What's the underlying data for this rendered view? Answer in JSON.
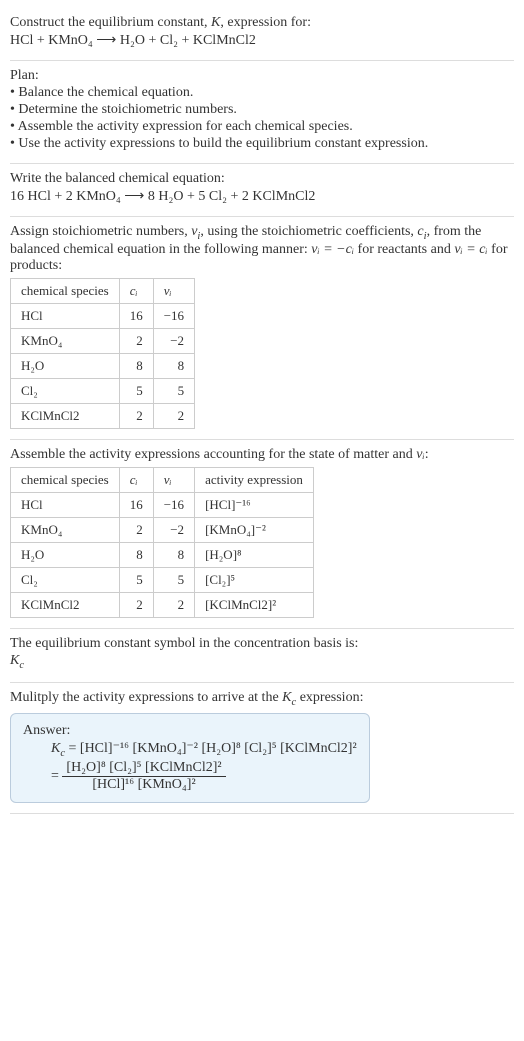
{
  "intro": {
    "l1_a": "Construct the equilibrium constant, ",
    "l1_b": "K",
    "l1_c": ", expression for:",
    "eq": "HCl + KMnO₄  ⟶  H₂O + Cl₂ + KClMnCl2"
  },
  "plan": {
    "heading": "Plan:",
    "b1": "• Balance the chemical equation.",
    "b2": "• Determine the stoichiometric numbers.",
    "b3": "• Assemble the activity expression for each chemical species.",
    "b4": "• Use the activity expressions to build the equilibrium constant expression."
  },
  "balanced": {
    "l1": "Write the balanced chemical equation:",
    "eq": "16 HCl + 2 KMnO₄  ⟶  8 H₂O + 5 Cl₂ + 2 KClMnCl2"
  },
  "stoich": {
    "desc_a": "Assign stoichiometric numbers, ",
    "desc_b": "ν",
    "desc_b_sub": "i",
    "desc_c": ", using the stoichiometric coefficients, ",
    "desc_d": "c",
    "desc_d_sub": "i",
    "desc_e": ", from the balanced chemical equation in the following manner: ",
    "rel1": "νᵢ = −cᵢ",
    "desc_f": " for reactants and ",
    "rel2": "νᵢ = cᵢ",
    "desc_g": " for products:",
    "headers": {
      "species": "chemical species",
      "c": "cᵢ",
      "nu": "νᵢ"
    },
    "rows": [
      {
        "species": "HCl",
        "c": "16",
        "nu": "−16"
      },
      {
        "species": "KMnO₄",
        "c": "2",
        "nu": "−2"
      },
      {
        "species": "H₂O",
        "c": "8",
        "nu": "8"
      },
      {
        "species": "Cl₂",
        "c": "5",
        "nu": "5"
      },
      {
        "species": "KClMnCl2",
        "c": "2",
        "nu": "2"
      }
    ]
  },
  "activity": {
    "desc_a": "Assemble the activity expressions accounting for the state of matter and ",
    "desc_b": "νᵢ",
    "desc_c": ":",
    "headers": {
      "species": "chemical species",
      "c": "cᵢ",
      "nu": "νᵢ",
      "act": "activity expression"
    },
    "rows": [
      {
        "species": "HCl",
        "c": "16",
        "nu": "−16",
        "act": "[HCl]⁻¹⁶"
      },
      {
        "species": "KMnO₄",
        "c": "2",
        "nu": "−2",
        "act": "[KMnO₄]⁻²"
      },
      {
        "species": "H₂O",
        "c": "8",
        "nu": "8",
        "act": "[H₂O]⁸"
      },
      {
        "species": "Cl₂",
        "c": "5",
        "nu": "5",
        "act": "[Cl₂]⁵"
      },
      {
        "species": "KClMnCl2",
        "c": "2",
        "nu": "2",
        "act": "[KClMnCl2]²"
      }
    ]
  },
  "symbol": {
    "l1": "The equilibrium constant symbol in the concentration basis is:",
    "l2": "K",
    "l2_sub": "c"
  },
  "final": {
    "l1_a": "Mulitply the activity expressions to arrive at the ",
    "l1_b": "K",
    "l1_b_sub": "c",
    "l1_c": " expression:",
    "answer_label": "Answer:",
    "lhs": "K",
    "lhs_sub": "c",
    "eq1_rhs": " = [HCl]⁻¹⁶ [KMnO₄]⁻² [H₂O]⁸ [Cl₂]⁵ [KClMnCl2]²",
    "eq2_prefix": "= ",
    "frac_num": "[H₂O]⁸ [Cl₂]⁵ [KClMnCl2]²",
    "frac_den": "[HCl]¹⁶ [KMnO₄]²"
  },
  "chart_data": {
    "type": "table",
    "tables": [
      {
        "title": "Stoichiometric numbers",
        "columns": [
          "chemical species",
          "cᵢ",
          "νᵢ"
        ],
        "rows": [
          [
            "HCl",
            16,
            -16
          ],
          [
            "KMnO₄",
            2,
            -2
          ],
          [
            "H₂O",
            8,
            8
          ],
          [
            "Cl₂",
            5,
            5
          ],
          [
            "KClMnCl2",
            2,
            2
          ]
        ]
      },
      {
        "title": "Activity expressions",
        "columns": [
          "chemical species",
          "cᵢ",
          "νᵢ",
          "activity expression"
        ],
        "rows": [
          [
            "HCl",
            16,
            -16,
            "[HCl]^-16"
          ],
          [
            "KMnO₄",
            2,
            -2,
            "[KMnO4]^-2"
          ],
          [
            "H₂O",
            8,
            8,
            "[H2O]^8"
          ],
          [
            "Cl₂",
            5,
            5,
            "[Cl2]^5"
          ],
          [
            "KClMnCl2",
            2,
            2,
            "[KClMnCl2]^2"
          ]
        ]
      }
    ]
  }
}
